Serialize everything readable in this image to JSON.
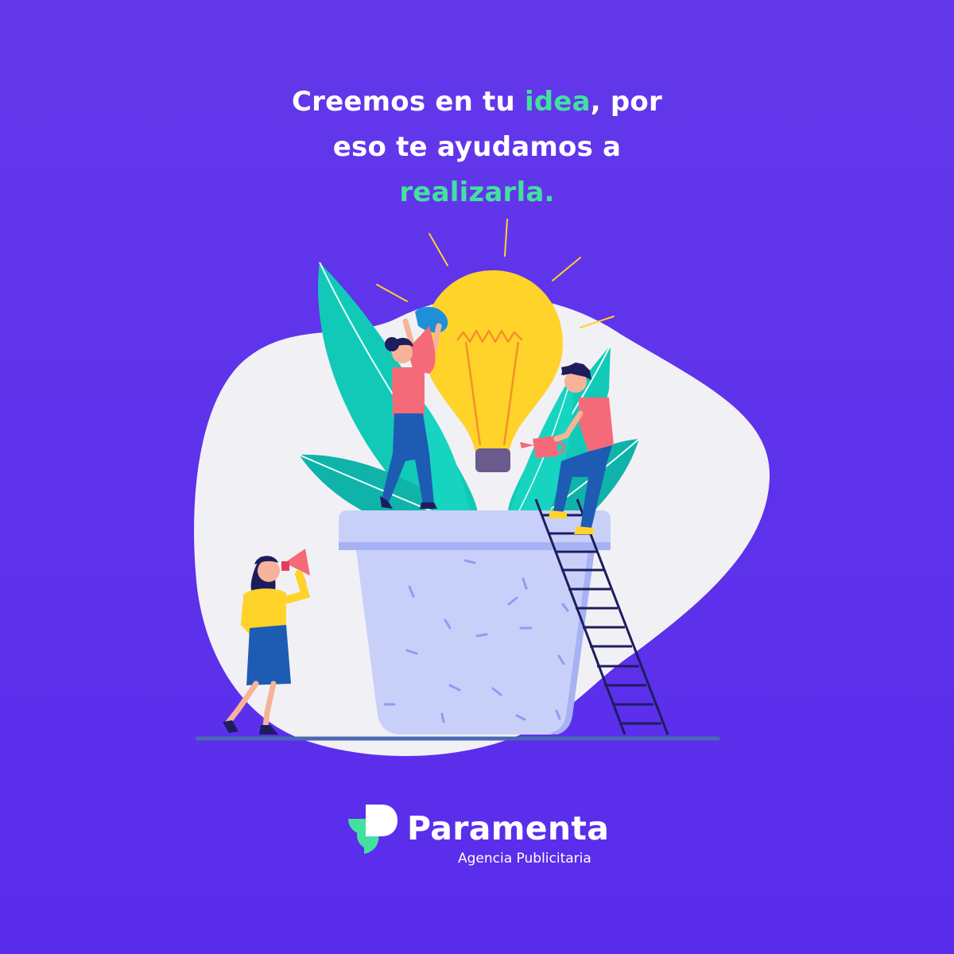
{
  "headline": {
    "line1_pre": "Creemos en tu ",
    "line1_highlight": "idea",
    "line1_post": ", por",
    "line2": "eso te ayudamos a",
    "line3_highlight": "realizarla."
  },
  "brand": {
    "name": "Paramenta",
    "tagline": "Agencia Publicitaria",
    "icon": "paramenta-logo-icon"
  },
  "colors": {
    "background": "#5e30ea",
    "accent": "#43e0a0",
    "blob": "#f1f1f5",
    "bulb": "#ffd32a",
    "pot": "#c8d0fa",
    "leaves": "#12c9b8",
    "shirt": "#f56a78"
  },
  "illustration": {
    "icons": [
      "lightbulb-icon",
      "plant-pot-icon",
      "ladder-icon",
      "megaphone-icon",
      "watering-can-icon"
    ]
  }
}
